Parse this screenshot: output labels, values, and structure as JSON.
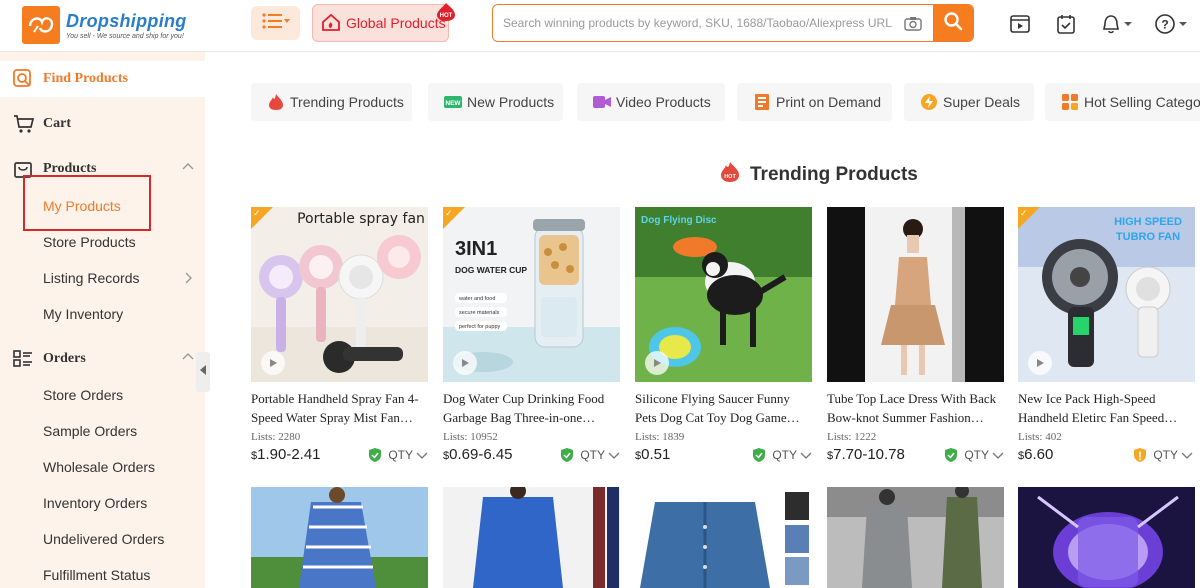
{
  "header": {
    "logo_title": "Dropshipping",
    "logo_subtitle": "You sell - We source and ship for you!",
    "global_label": "Global Products",
    "global_badge": "HOT",
    "search_placeholder": "Search winning products by keyword, SKU, 1688/Taobao/Aliexpress URL",
    "icons": [
      "menu-icon",
      "video-icon",
      "task-icon",
      "bell-icon",
      "help-icon"
    ]
  },
  "sidebar": {
    "find_products": "Find Products",
    "cart": "Cart",
    "products": "Products",
    "product_items": [
      "My Products",
      "Store Products",
      "Listing Records",
      "My Inventory"
    ],
    "orders": "Orders",
    "order_items": [
      "Store Orders",
      "Sample Orders",
      "Wholesale Orders",
      "Inventory Orders",
      "Undelivered Orders",
      "Fulfillment Status"
    ]
  },
  "tabs": [
    "Trending Products",
    "New Products",
    "Video Products",
    "Print on Demand",
    "Super Deals",
    "Hot Selling Categori"
  ],
  "tab_badge_new": "NEW",
  "section_title": "Trending Products",
  "section_icon_text": "HOT",
  "qty_label": "QTY",
  "products": [
    {
      "title": "Portable Handheld Spray Fan 4-Speed Water Spray Mist Fan…",
      "lists": "Lists: 2280",
      "price": "1.90-2.41",
      "currency": "$",
      "image_text": "Portable spray fan",
      "shield": "green"
    },
    {
      "title": "Dog Water Cup Drinking Food Garbage Bag Three-in-one…",
      "lists": "Lists: 10952",
      "price": "0.69-6.45",
      "currency": "$",
      "image_text": "3IN1",
      "image_subtext": "DOG WATER CUP",
      "image_bullets": [
        "water and food",
        "secure materials",
        "perfect for puppy"
      ],
      "shield": "green"
    },
    {
      "title": "Silicone Flying Saucer Funny Pets Dog Cat Toy Dog Game…",
      "lists": "Lists: 1839",
      "price": "0.51",
      "currency": "$",
      "image_text": "Dog Flying Disc",
      "shield": "green"
    },
    {
      "title": "Tube Top Lace Dress With Back Bow-knot Summer Fashion…",
      "lists": "Lists: 1222",
      "price": "7.70-10.78",
      "currency": "$",
      "shield": "green"
    },
    {
      "title": "New Ice Pack High-Speed Handheld Eletirc Fan Speed…",
      "lists": "Lists: 402",
      "price": "6.60",
      "currency": "$",
      "image_text": "HIGH SPEED",
      "image_subtext": "TUBRO FAN",
      "shield": "orange"
    }
  ],
  "colors": {
    "accent": "#f57c1f",
    "brand_blue": "#2a7ec9",
    "hot_red": "#e0202a",
    "sidebar_bg": "#fdf3ea",
    "highlight": "#d62828"
  }
}
